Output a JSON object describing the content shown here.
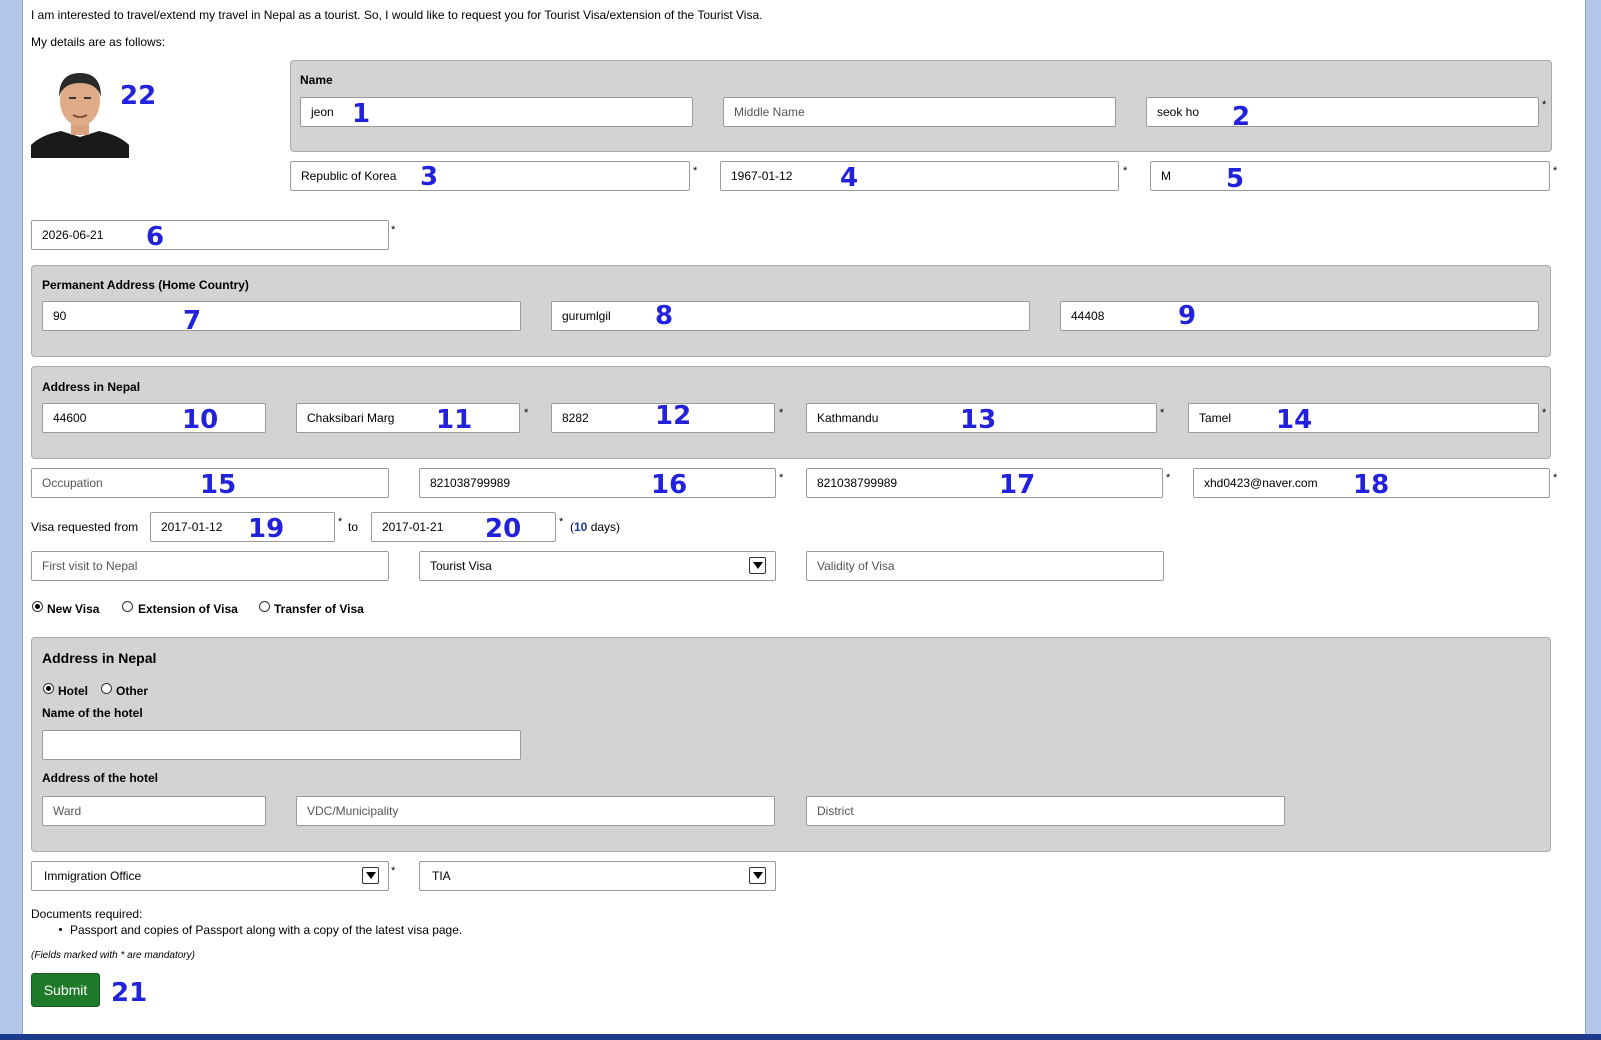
{
  "intro": {
    "line1": "I am interested to travel/extend my travel in Nepal as a tourist. So, I would like to request you for Tourist Visa/extension of the Tourist Visa.",
    "line2": "My details are as follows:"
  },
  "photo": {
    "number": "22"
  },
  "name_section": {
    "title": "Name",
    "first_name": {
      "value": "jeon",
      "number": "1"
    },
    "middle_name": {
      "placeholder": "Middle Name"
    },
    "last_name": {
      "value": "seok ho",
      "number": "2"
    }
  },
  "personal": {
    "nationality": {
      "value": "Republic of Korea",
      "number": "3"
    },
    "dob": {
      "value": "1967-01-12",
      "number": "4"
    },
    "gender": {
      "value": "M",
      "number": "5"
    },
    "passport_expiry": {
      "value": "2026-06-21",
      "number": "6"
    }
  },
  "permanent_address": {
    "title": "Permanent Address (Home Country)",
    "house_no": {
      "value": "90",
      "number": "7"
    },
    "street": {
      "value": "gurumlgil",
      "number": "8"
    },
    "postcode": {
      "value": "44408",
      "number": "9"
    }
  },
  "nepal_address": {
    "title": "Address in Nepal",
    "postal": {
      "value": "44600",
      "number": "10"
    },
    "street": {
      "value": "Chaksibari Marg",
      "number": "11"
    },
    "house_no": {
      "value": "8282",
      "number": "12"
    },
    "city": {
      "value": "Kathmandu",
      "number": "13"
    },
    "area": {
      "value": "Tamel",
      "number": "14"
    }
  },
  "contact": {
    "occupation": {
      "placeholder": "Occupation",
      "number": "15"
    },
    "phone1": {
      "value": "821038799989",
      "number": "16"
    },
    "phone2": {
      "value": "821038799989",
      "number": "17"
    },
    "email": {
      "value": "xhd0423@naver.com",
      "number": "18"
    }
  },
  "visa_period": {
    "label": "Visa requested from",
    "from": {
      "value": "2017-01-12",
      "number": "19"
    },
    "to_label": "to",
    "to": {
      "value": "2017-01-21",
      "number": "20"
    },
    "days_open": "(",
    "days_count": "10",
    "days_close": " days)"
  },
  "visa_info": {
    "first_visit": {
      "placeholder": "First visit to Nepal"
    },
    "visa_type": {
      "selected": "Tourist Visa"
    },
    "validity": {
      "placeholder": "Validity of Visa"
    }
  },
  "visa_kind": {
    "options": [
      "New Visa",
      "Extension of Visa",
      "Transfer of Visa"
    ],
    "selected": "New Visa"
  },
  "stay": {
    "title": "Address in Nepal",
    "options": [
      "Hotel",
      "Other"
    ],
    "selected": "Hotel",
    "hotel_name_label": "Name of the hotel",
    "hotel_address_label": "Address of the hotel",
    "ward": {
      "placeholder": "Ward"
    },
    "municipality": {
      "placeholder": "VDC/Municipality"
    },
    "district": {
      "placeholder": "District"
    }
  },
  "office": {
    "type": {
      "selected": "Immigration Office"
    },
    "location": {
      "selected": "TIA"
    }
  },
  "documents": {
    "title": "Documents required:",
    "items": [
      "Passport and copies of Passport along with a copy of the latest visa page."
    ]
  },
  "mandatory_note": "(Fields marked with * are mandatory)",
  "submit": {
    "label": "Submit",
    "number": "21"
  },
  "required_mark": "*",
  "colors": {
    "submit_bg": "#1e7a2a",
    "panel_bg": "#d3d3d3",
    "annotation": "#2222dd",
    "sidebar": "#b3c8e8"
  }
}
